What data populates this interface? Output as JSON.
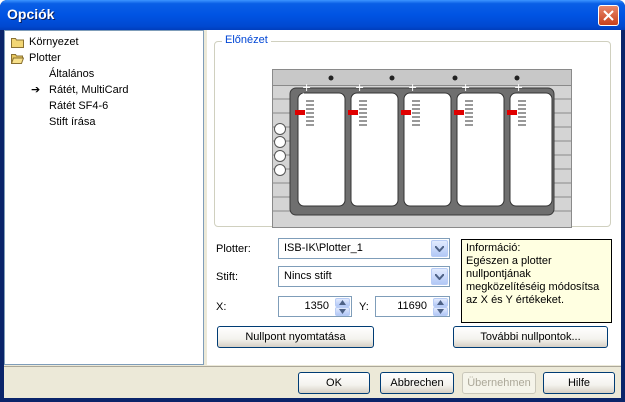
{
  "window": {
    "title": "Opciók"
  },
  "tree": {
    "items": [
      {
        "label": "Környezet",
        "icon": "folder-closed-icon"
      },
      {
        "label": "Plotter",
        "icon": "folder-open-icon"
      },
      {
        "label": "Általános"
      },
      {
        "label": "Rátét, MultiCard",
        "selected": true
      },
      {
        "label": "Rátét SF4-6"
      },
      {
        "label": "Stift írása"
      }
    ]
  },
  "preview": {
    "label": "Előnézet"
  },
  "form": {
    "plotter_label": "Plotter:",
    "plotter_value": "ISB-IK\\Plotter_1",
    "stift_label": "Stift:",
    "stift_value": "Nincs stift",
    "x_label": "X:",
    "x_value": "1350",
    "y_label": "Y:",
    "y_value": "11690"
  },
  "info": {
    "text": "Információ:\nEgészen a plotter nullpontjának megközelítéséig módosítsa az X és Y értékeket."
  },
  "buttons": {
    "print_null": "Nullpont nyomtatása",
    "more_null": "További nullpontok...",
    "ok": "OK",
    "cancel": "Abbrechen",
    "apply": "Übernehmen",
    "help": "Hilfe"
  },
  "colors": {
    "titlebar": "#0054e3",
    "accent": "#0046d5",
    "pen_marker": "#e00000",
    "info_bg": "#ffffe1"
  }
}
